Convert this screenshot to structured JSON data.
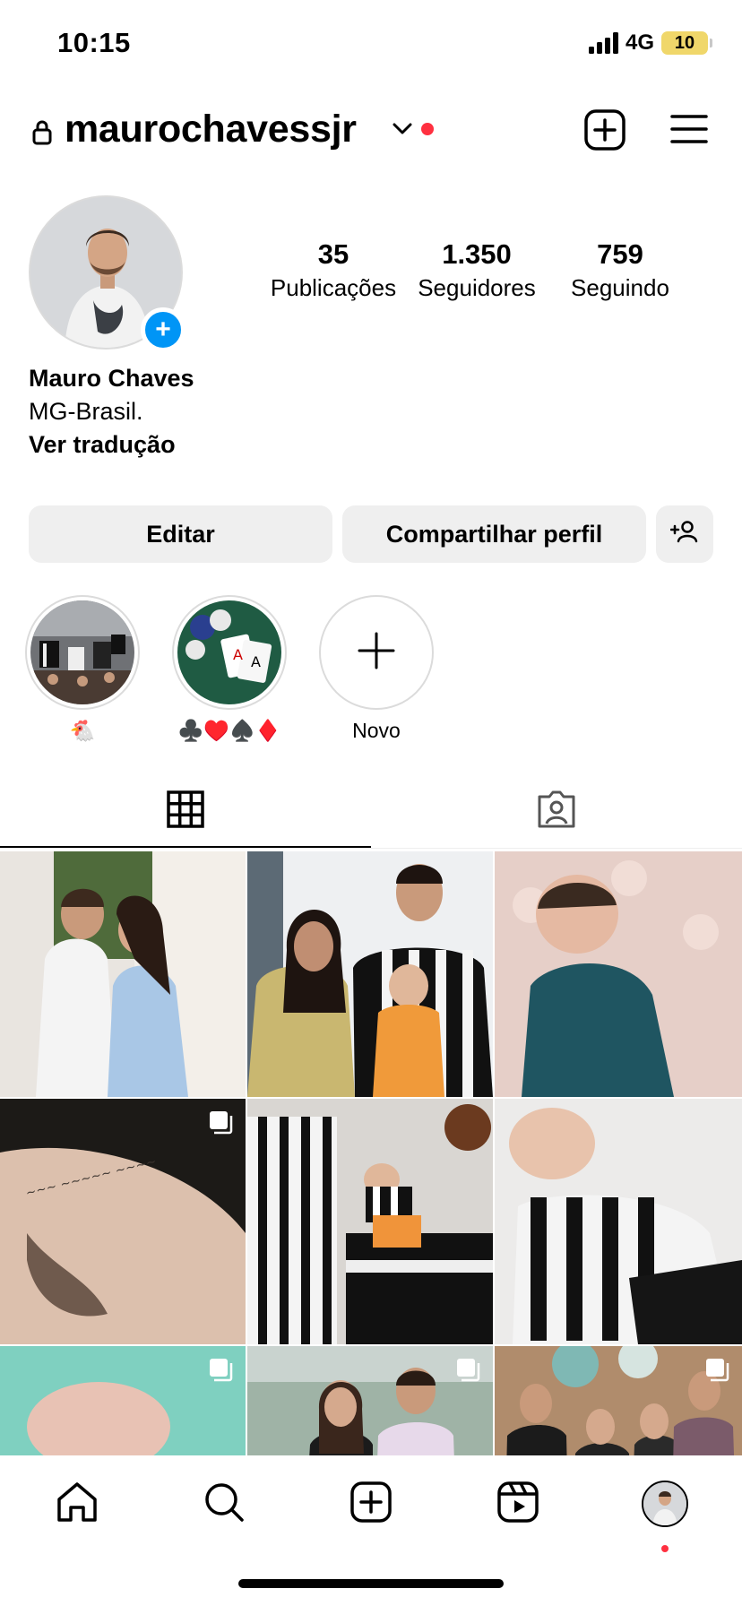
{
  "status_bar": {
    "time": "10:15",
    "network": "4G",
    "battery": "10"
  },
  "header": {
    "username": "maurochavessjr"
  },
  "profile": {
    "stats": [
      {
        "count": "35",
        "label": "Publicações"
      },
      {
        "count": "1.350",
        "label": "Seguidores"
      },
      {
        "count": "759",
        "label": "Seguindo"
      }
    ],
    "name": "Mauro Chaves",
    "location": "MG-Brasil.",
    "translate_label": "Ver tradução"
  },
  "actions": {
    "edit": "Editar",
    "share": "Compartilhar perfil"
  },
  "highlights": [
    {
      "label": "🐔"
    },
    {
      "label": "♣️♥️♠️♦️"
    },
    {
      "label": "Novo"
    }
  ],
  "icons": {
    "lock": "lock-icon",
    "dropdown": "chevron-down-icon",
    "create": "plus-square-icon",
    "menu": "hamburger-icon",
    "add_person": "add-person-icon",
    "grid": "grid-icon",
    "tagged": "tagged-person-icon",
    "home": "home-icon",
    "search": "search-icon",
    "reels": "reels-icon",
    "multi": "multiple-photos-icon"
  },
  "colors": {
    "accent_blue": "#0095f6",
    "notification_red": "#ff3040",
    "button_bg": "#efefef",
    "battery": "#f0d76a"
  }
}
